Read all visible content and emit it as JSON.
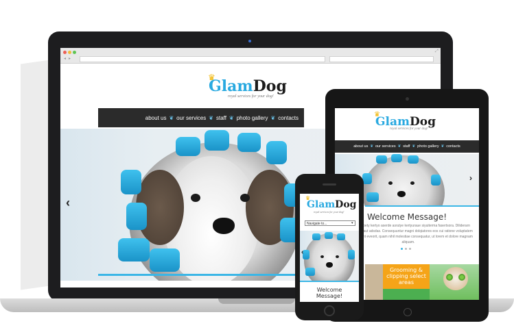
{
  "nav": {
    "items": [
      "about us",
      "our services",
      "staff",
      "photo gallery",
      "contacts"
    ],
    "separator": "❦"
  },
  "logo": {
    "glam": "Glam",
    "dog": "Dog",
    "tagline": "royal services for your dog!"
  },
  "hero": {
    "prev_arrow": "‹",
    "next_arrow": "›"
  },
  "tablet": {
    "welcome_title": "Welcome Message!",
    "welcome_text": "Praesent aoety kertyo aserde asrutye kertyuraue siyuiterma fasertsora. Diliderarn aeralom ertr aut adsdas. Consequuntur magni dolqiatores eos cui ratione voluptatem sequi nesciunt eveorit, quam nihil molestiae consequatur, ut lorem et dolore magnam aliquam.",
    "tile_label": "Grooming & clipping select areas"
  },
  "phone": {
    "select_value": "Navigate to...",
    "welcome_title": "Welcome Message!"
  },
  "colors": {
    "brand_blue": "#29a9e0",
    "nav_bg": "#2b2b2b",
    "tile_orange": "#f5a418",
    "tile_green": "#4caf50"
  }
}
